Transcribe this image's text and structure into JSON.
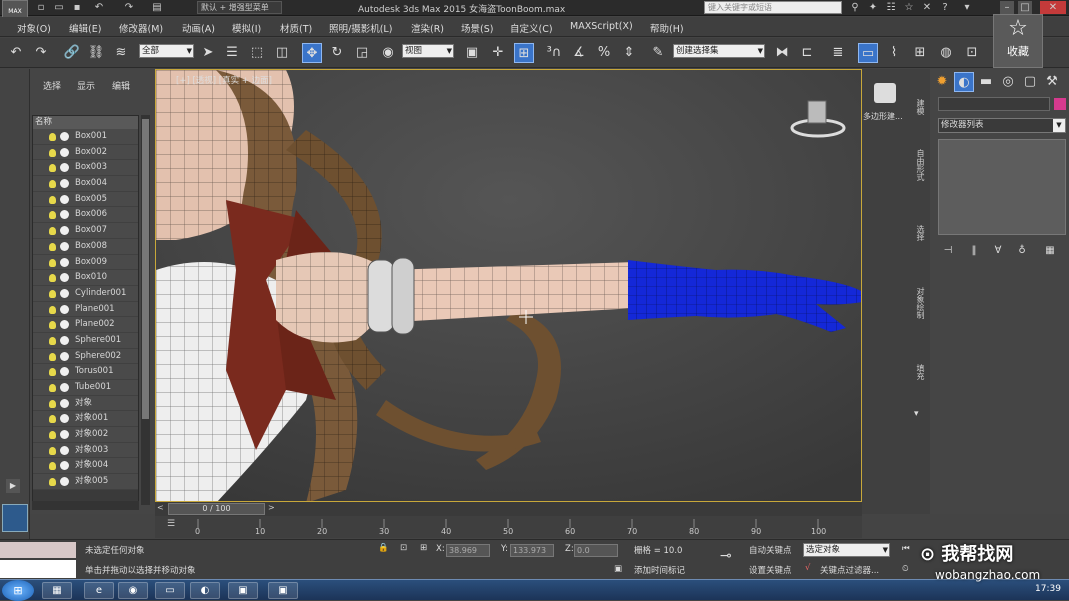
{
  "titlebar": {
    "workspace": "默认 + 增强型菜单",
    "title": "Autodesk 3ds Max 2015    女海盗ToonBoom.max",
    "search_placeholder": "键入关键字或短语",
    "logo": "MAX"
  },
  "menu": [
    "对象(O)",
    "编辑(E)",
    "修改器(M)",
    "动画(A)",
    "模拟(I)",
    "材质(T)",
    "照明/摄影机(L)",
    "渲染(R)",
    "场景(S)",
    "自定义(C)",
    "MAXScript(X)",
    "帮助(H)"
  ],
  "toolbar": {
    "filter_value": "全部",
    "ref_coord_value": "视图",
    "named_selection_value": "创建选择集"
  },
  "favorite": {
    "icon": "star-icon",
    "label": "收藏"
  },
  "scene_explorer": {
    "tabs": [
      "选择",
      "显示",
      "编辑"
    ],
    "column_header": "名称",
    "items": [
      "Box001",
      "Box002",
      "Box003",
      "Box004",
      "Box005",
      "Box006",
      "Box007",
      "Box008",
      "Box009",
      "Box010",
      "Cylinder001",
      "Plane001",
      "Plane002",
      "Sphere001",
      "Sphere002",
      "Torus001",
      "Tube001",
      "对象",
      "对象001",
      "对象002",
      "对象003",
      "对象004",
      "对象005"
    ]
  },
  "viewport": {
    "label": "[+] [透视] [真实 + 边面]",
    "colors": {
      "border": "#c8a83a",
      "glove": "#1428d8",
      "skin": "#e8c6b4",
      "hair": "#7a5a3a",
      "collar": "#7a2a1e"
    }
  },
  "command_panel": {
    "side_tabs": [
      "建模",
      "自由形式",
      "选择",
      "对象绘制",
      "填充"
    ],
    "graphite_label": "多边形建...",
    "modifier_list": "修改器列表",
    "name_swatch_color": "#d63a8e"
  },
  "timeline": {
    "frame_display": "0 / 100",
    "ticks": [
      "0",
      "10",
      "20",
      "30",
      "40",
      "50",
      "60",
      "70",
      "80",
      "90",
      "100"
    ]
  },
  "status": {
    "line1": "未选定任何对象",
    "line2": "单击并拖动以选择并移动对象",
    "x_label": "X:",
    "x_value": "38.969",
    "y_label": "Y:",
    "y_value": "133.973",
    "z_label": "Z:",
    "z_value": "0.0",
    "grid": "栅格 = 10.0",
    "auto_key": "自动关键点",
    "set_key": "设置关键点",
    "selected_dropdown": "选定对象",
    "key_filter": "关键点过滤器...",
    "add_time_tag": "添加时间标记"
  },
  "taskbar": {
    "clock": "17:39"
  },
  "watermark": {
    "text": "我帮找网",
    "url": "wobangzhao.com"
  }
}
